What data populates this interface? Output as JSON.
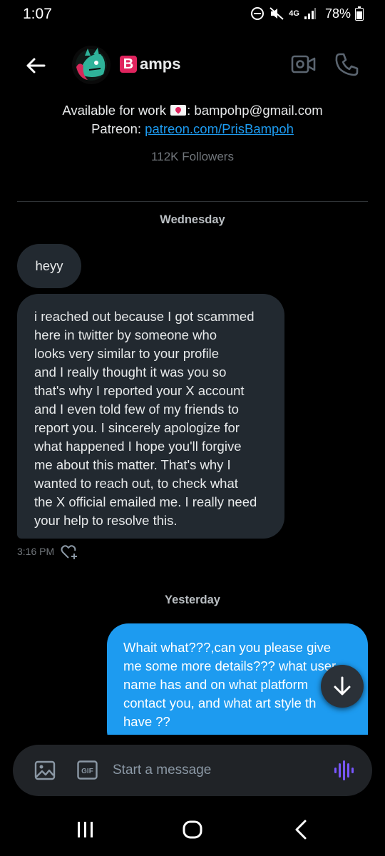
{
  "status_bar": {
    "time": "1:07",
    "network": "4G",
    "battery": "78%"
  },
  "header": {
    "name_badge": "B",
    "name_rest": "amps"
  },
  "profile": {
    "bio_prefix": "Available for work ",
    "bio_suffix": ": bampohp@gmail.com",
    "patreon_label": "Patreon: ",
    "patreon_link": "patreon.com/PrisBampoh",
    "followers": "112K Followers"
  },
  "conversation": {
    "day1": "Wednesday",
    "msg1": "heyy",
    "msg2_lines": [
      "i  reached out because I got scammed",
      "here in twitter by someone who",
      "looks very similar to your profile",
      "and I really thought it was you so",
      "that's why I reported your X account",
      "and I even told few of my friends to",
      "report you. I sincerely apologize for",
      "what happened I hope you'll forgive",
      "me about this matter. That's why I",
      "wanted to reach out, to check what",
      "the X official emailed me. I really need",
      "your help to resolve this."
    ],
    "msg2_time": "3:16 PM",
    "day2": "Yesterday",
    "msg3_lines": [
      "Whait what???,can you please give",
      "me some more details??? what user",
      "name has and on what platform",
      "contact you, and what art style th",
      "have ??"
    ]
  },
  "composer": {
    "placeholder": "Start a message"
  },
  "colors": {
    "accent": "#1d9bf0",
    "incoming_bubble": "#222930",
    "voice_icon": "#7856ff"
  }
}
